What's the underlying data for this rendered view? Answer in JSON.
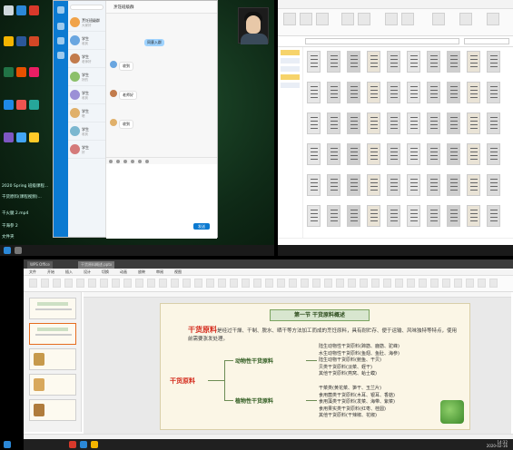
{
  "desktop": {
    "icons": [
      "Recycle Bin",
      "Tencent QQ",
      "WPS",
      "Chrome",
      "Word",
      "PowerPoint",
      "Excel",
      "Maps",
      "QQ Music",
      "Alipay"
    ],
    "bottom_texts": [
      "2020 Spring 班级课程...",
      "干货原料(课程视频)...",
      "干火腿 2.mp4",
      "干海参 2",
      "文件夹"
    ]
  },
  "chat": {
    "title": "烹饪班级群",
    "contacts": [
      {
        "name": "烹饪班级群",
        "msg": "大家好"
      },
      {
        "name": "学生",
        "msg": "收到"
      },
      {
        "name": "学生",
        "msg": "老师好"
      },
      {
        "name": "学生",
        "msg": "好的"
      },
      {
        "name": "学生",
        "msg": "收到"
      },
      {
        "name": "学生",
        "msg": "嗯"
      },
      {
        "name": "学生",
        "msg": "收到"
      },
      {
        "name": "学生",
        "msg": "好"
      }
    ],
    "messages": [
      {
        "side": "right",
        "text": "同意入群"
      },
      {
        "side": "left",
        "text": "收到"
      },
      {
        "side": "left",
        "text": "老师好"
      },
      {
        "side": "left",
        "text": "收到"
      }
    ],
    "send_label": "发送"
  },
  "explorer": {
    "items_count": 60
  },
  "presentation": {
    "tabs": [
      "WPS Office",
      "干货原料概述.pptx"
    ],
    "menu": [
      "文件",
      "开始",
      "插入",
      "设计",
      "切换",
      "动画",
      "放映",
      "审阅",
      "视图"
    ],
    "slide": {
      "banner": "第一节 干货原料概述",
      "intro_head": "干货原料",
      "intro_text": "是经过干燥、干制、脱水、晒干等方法加工而成的烹饪原料，具有耐贮存、便于运输、风味独特等特点，使用前需要涨发处理。",
      "hub": "干货原料",
      "branches": [
        "动物性干货原料",
        "植物性干货原料"
      ],
      "animal_nodes": [
        "陆生动物性干货原料(蹄筋、鹿筋、驼峰)",
        "水生动物性干货原料(鱼翅、鱼肚、海参)",
        "陆生动物干货原料(鲍鱼、干贝)",
        "贝类干货原料(淡菜、蛏干)",
        "其他干货原料(燕窝、蛤士蟆)"
      ],
      "plant_nodes": [
        "干菜类(黄花菜、笋干、玉兰片)",
        "食用菌类干货原料(木耳、银耳、香菇)",
        "食用藻类干货原料(发菜、海带、紫菜)",
        "食用果实类干货原料(红枣、桂圆)",
        "其他干货原料(干辣椒、花椒)"
      ]
    },
    "clock_time": "14:32",
    "clock_date": "2020-02-16"
  }
}
